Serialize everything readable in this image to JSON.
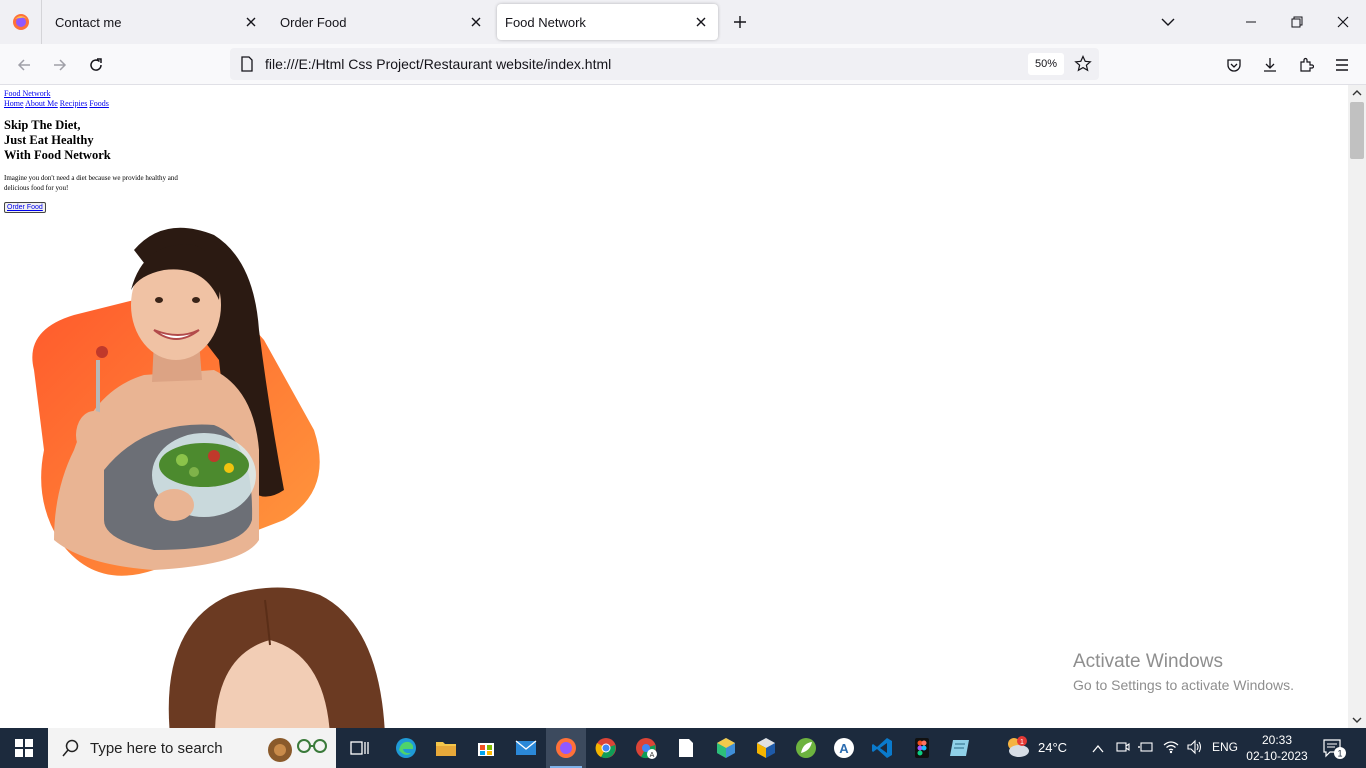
{
  "browser": {
    "tabs": [
      {
        "title": "Contact me",
        "active": false
      },
      {
        "title": "Order Food",
        "active": false
      },
      {
        "title": "Food Network",
        "active": true
      }
    ],
    "url": "file:///E:/Html Css Project/Restaurant website/index.html",
    "zoom": "50%"
  },
  "site": {
    "brand": "Food Network",
    "nav": [
      "Home",
      "About Me",
      "Recipies",
      "Foods"
    ],
    "hero": {
      "title_lines": [
        "Skip The Diet,",
        "Just Eat Healthy",
        "With Food Network"
      ],
      "text": "Imagine you don't need a diet because we provide healthy and delicious food for you!",
      "button": "Order Food"
    }
  },
  "watermark": {
    "title": "Activate Windows",
    "subtitle": "Go to Settings to activate Windows."
  },
  "taskbar": {
    "search_placeholder": "Type here to search",
    "weather": "24°C",
    "language": "ENG",
    "time": "20:33",
    "date": "02-10-2023",
    "notification_count": "1",
    "weather_badge": "1"
  },
  "colors": {
    "taskbar": "#1c2a3d",
    "link": "#0000ee",
    "blob_orange": "#ff8a3d",
    "blob_red": "#ff5a2c"
  }
}
